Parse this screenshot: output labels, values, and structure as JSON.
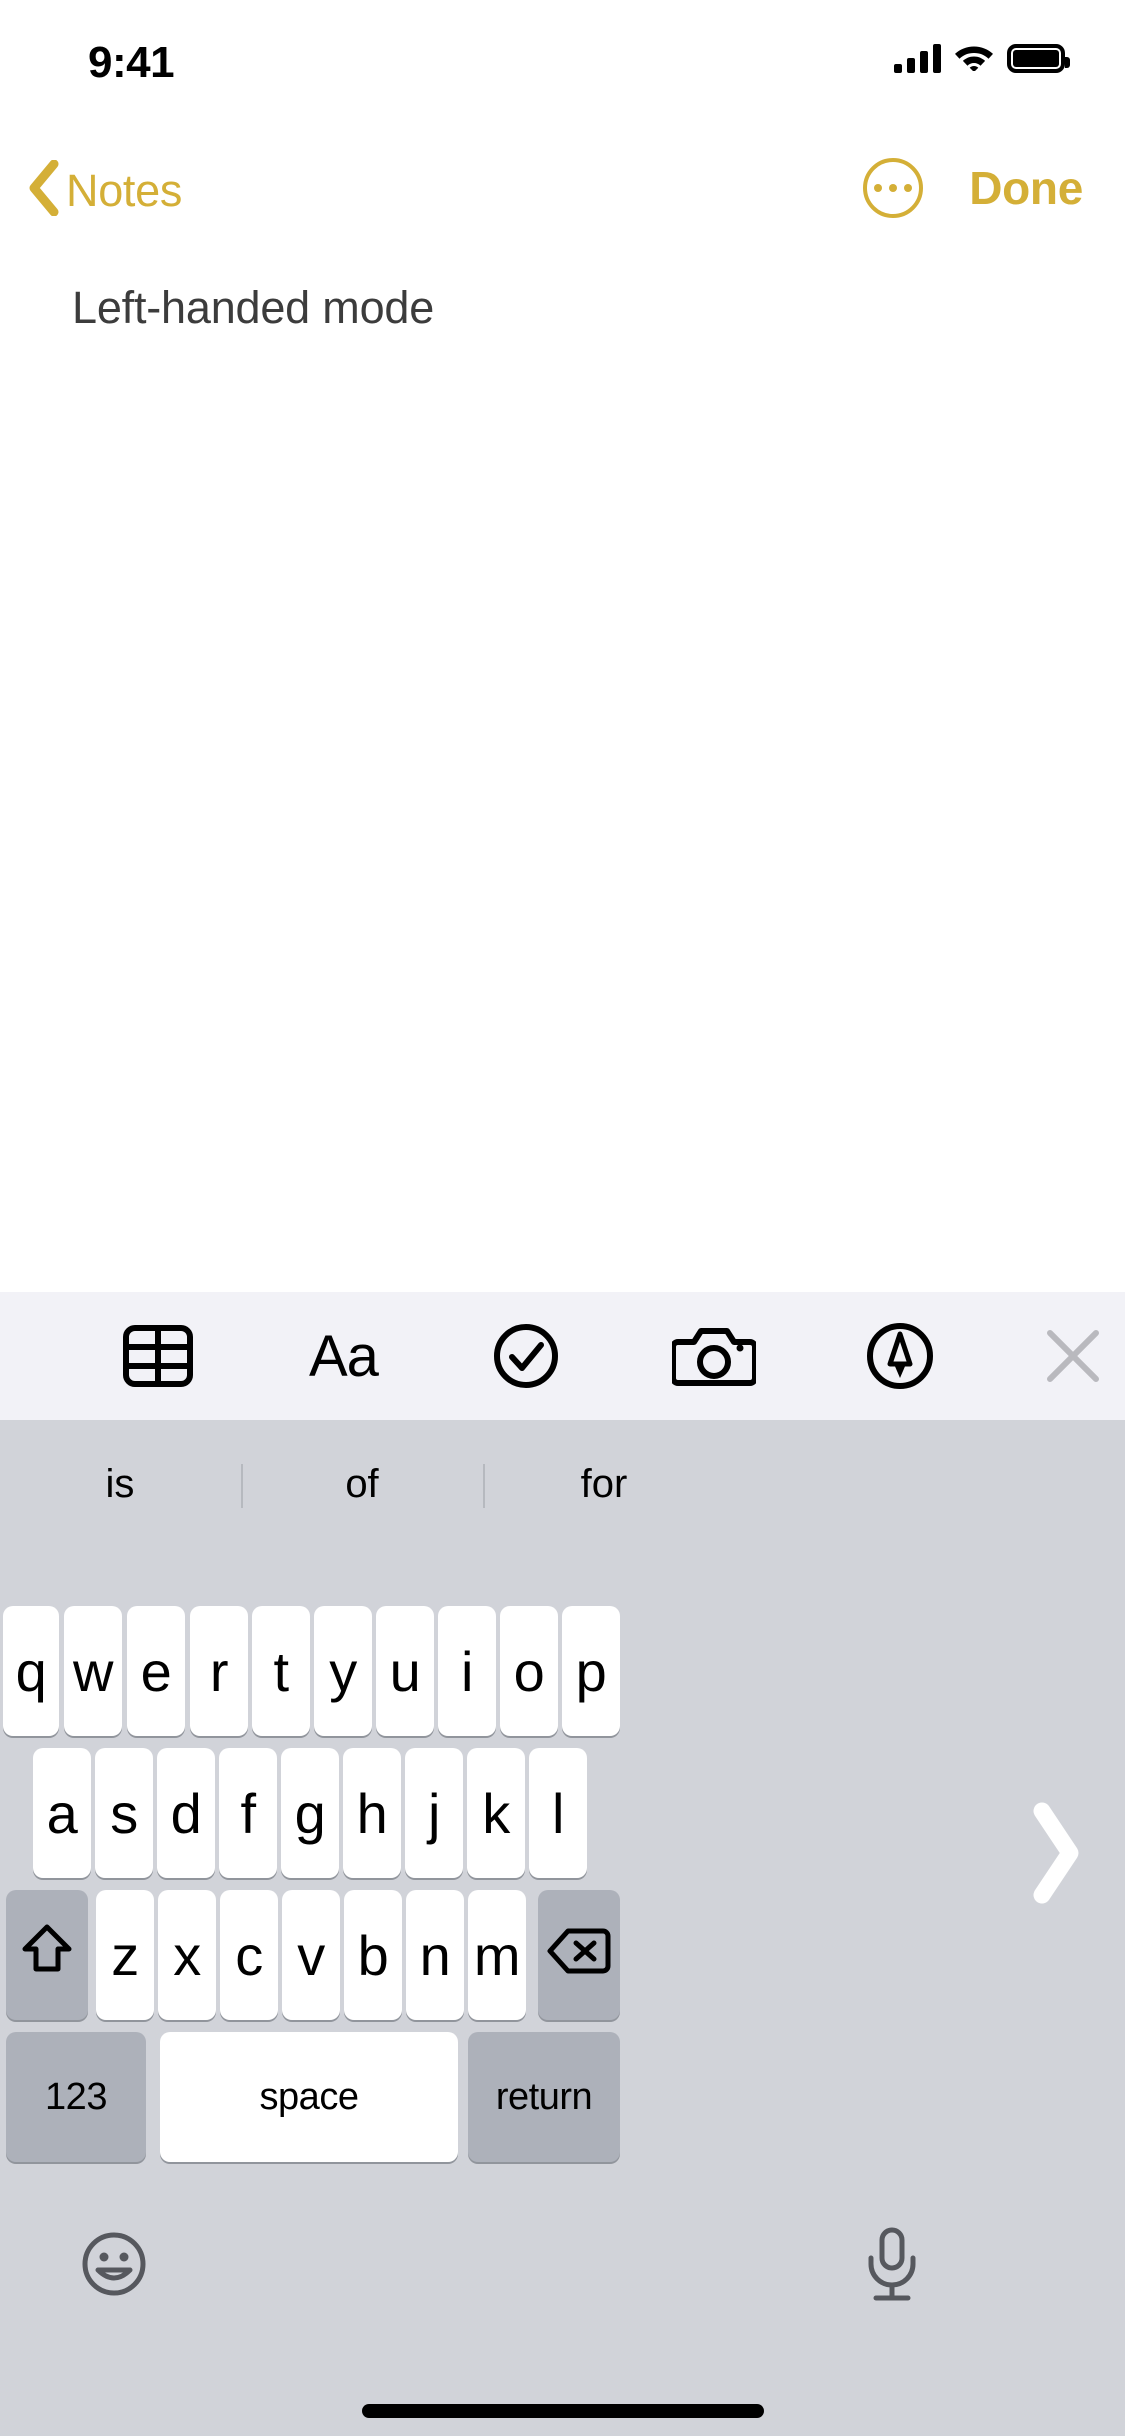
{
  "status_bar": {
    "time": "9:41",
    "signal_icon": "cellular-signal-icon",
    "wifi_icon": "wifi-icon",
    "battery_icon": "battery-full-icon"
  },
  "nav_bar": {
    "back_label": "Notes",
    "back_icon": "chevron-left-icon",
    "more_icon": "ellipsis-circle-icon",
    "done_label": "Done",
    "accent_color": "#D4AF37"
  },
  "note": {
    "text": "Left-handed mode",
    "text_color": "#3C3C3C"
  },
  "format_toolbar": {
    "background": "#F2F2F7",
    "items": [
      {
        "name": "table-icon",
        "label": ""
      },
      {
        "name": "text-format-icon",
        "label": "Aa"
      },
      {
        "name": "checklist-circle-icon",
        "label": ""
      },
      {
        "name": "camera-icon",
        "label": ""
      },
      {
        "name": "markup-pen-icon",
        "label": ""
      },
      {
        "name": "close-icon",
        "label": ""
      }
    ]
  },
  "keyboard": {
    "background": "#D1D3D9",
    "key_color": "#FFFFFF",
    "modifier_key_color": "#ADB1BA",
    "layout_mode": "left-handed",
    "predictions": [
      "is",
      "of",
      "for"
    ],
    "row1": [
      "q",
      "w",
      "e",
      "r",
      "t",
      "y",
      "u",
      "i",
      "o",
      "p"
    ],
    "row2": [
      "a",
      "s",
      "d",
      "f",
      "g",
      "h",
      "j",
      "k",
      "l"
    ],
    "row3": [
      "z",
      "x",
      "c",
      "v",
      "b",
      "n",
      "m"
    ],
    "shift_icon": "shift-arrow-icon",
    "delete_icon": "delete-backspace-icon",
    "numbers_label": "123",
    "space_label": "space",
    "return_label": "return",
    "expand_handle_icon": "chevron-right-icon",
    "emoji_icon": "emoji-smiley-icon",
    "mic_icon": "microphone-icon"
  },
  "home_indicator": "home-indicator-bar"
}
